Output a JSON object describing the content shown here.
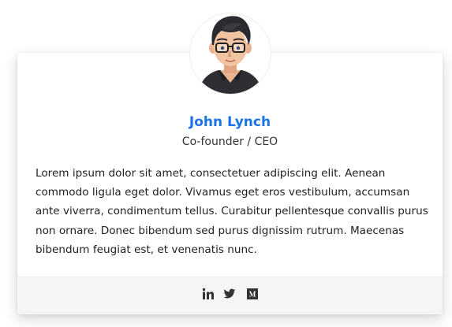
{
  "profile": {
    "name": "John Lynch",
    "role": "Co-founder / CEO",
    "bio": "Lorem ipsum dolor sit amet, consectetuer adipiscing elit. Aenean commodo ligula eget dolor. Vivamus eget eros vestibulum, accumsan ante viverra, condimentum tellus. Curabitur pellentesque convallis purus non ornare. Donec bibendum sed purus dignissim rutrum. Maecenas bibendum feugiat est, et venenatis nunc."
  },
  "social": [
    {
      "icon": "linkedin-icon"
    },
    {
      "icon": "twitter-icon"
    },
    {
      "icon": "medium-icon"
    }
  ],
  "colors": {
    "name": "#1a73e8",
    "text": "#222222",
    "footer_bg": "#f5f5f5",
    "icon": "#333333"
  }
}
